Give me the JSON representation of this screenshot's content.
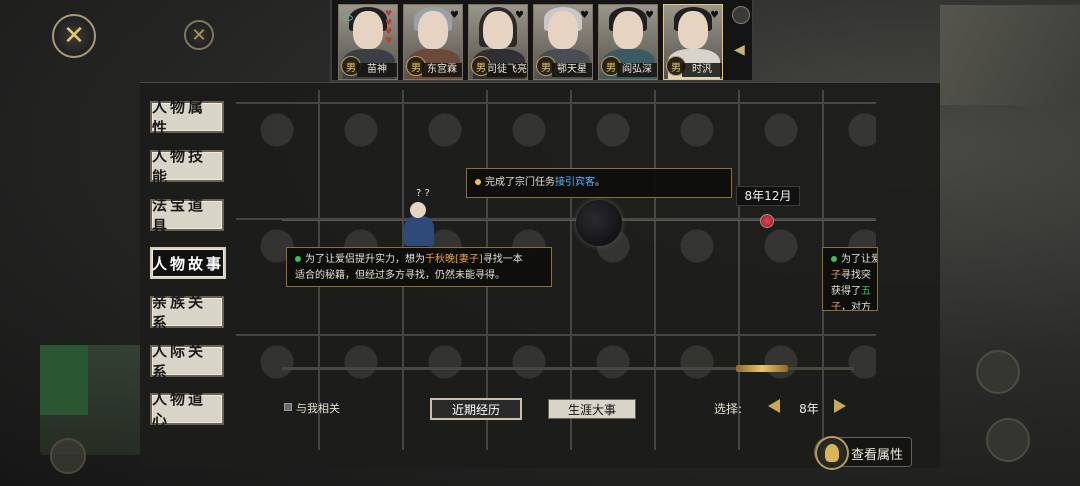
{
  "characters": [
    {
      "name": "苗神",
      "gender": "男",
      "hearts": [
        "♥",
        "♥",
        "♥",
        "♥"
      ],
      "selected": false
    },
    {
      "name": "东宫霖",
      "gender": "男"
    },
    {
      "name": "司徒飞亮",
      "gender": "男"
    },
    {
      "name": "鄂天星",
      "gender": "男"
    },
    {
      "name": "阎弘深",
      "gender": "男"
    },
    {
      "name": "时汎",
      "gender": "男",
      "selected": true
    }
  ],
  "tabs": [
    {
      "label": "人物属性",
      "active": false
    },
    {
      "label": "人物技能",
      "active": false
    },
    {
      "label": "法宝道具",
      "active": false
    },
    {
      "label": "人物故事",
      "active": true
    },
    {
      "label": "亲族关系",
      "active": false
    },
    {
      "label": "人际关系",
      "active": false
    },
    {
      "label": "人物道心",
      "active": false
    }
  ],
  "timeline": {
    "date": "8年12月",
    "event_top": {
      "text_before": "完成了宗门任务",
      "highlight": "接引宾客",
      "text_after": "。"
    },
    "event_left": {
      "line1_before": "为了让爱侣提升实力，想为",
      "line1_highlight": "千秋晚[妻子]",
      "line1_after": "寻找一本",
      "line2": "适合的秘籍，但经过多方寻找，仍然未能寻得。"
    },
    "event_right": {
      "line1": "为了让爱",
      "line2_highlight": "子",
      "line2_rest": "寻找突",
      "line3_before": "获得了",
      "line3_highlight": "五",
      "line4_highlight": "子",
      "line4_rest": "，对方"
    }
  },
  "controls": {
    "related_label": "与我相关",
    "recent_label": "近期经历",
    "career_label": "生涯大事",
    "select_label": "选择:",
    "select_value": "8年"
  },
  "view_attributes_label": "查看属性",
  "close_icon": "✕",
  "colors": {
    "accent_gold": "#e8c66a",
    "highlight_blue": "#5ab4ff",
    "highlight_orange": "#e8a040",
    "highlight_green": "#3fbf5a",
    "dot_yellow": "#f0c040",
    "dot_green": "#3fbf5a"
  }
}
